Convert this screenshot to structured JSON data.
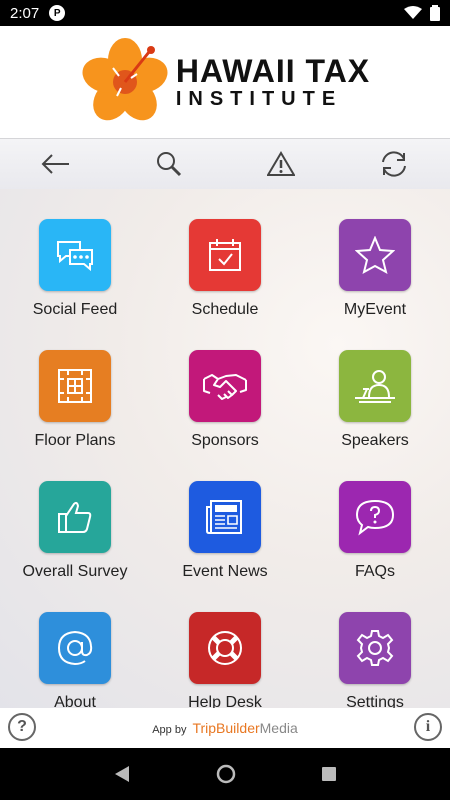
{
  "status_bar": {
    "time": "2:07",
    "notification_badge": "P"
  },
  "header": {
    "logo_line1": "HAWAII TAX",
    "logo_line2": "INSTITUTE"
  },
  "toolbar": {
    "icons": [
      "back-arrow-icon",
      "search-icon",
      "alert-icon",
      "refresh-icon"
    ]
  },
  "tiles": [
    {
      "label": "Social Feed",
      "color": "#29B6F6",
      "icon": "chat-bubbles-icon"
    },
    {
      "label": "Schedule",
      "color": "#E53935",
      "icon": "calendar-icon"
    },
    {
      "label": "MyEvent",
      "color": "#8E44AD",
      "icon": "star-icon"
    },
    {
      "label": "Floor Plans",
      "color": "#E67E22",
      "icon": "floor-plan-icon"
    },
    {
      "label": "Sponsors",
      "color": "#C2187A",
      "icon": "handshake-icon"
    },
    {
      "label": "Speakers",
      "color": "#8CB63F",
      "icon": "speaker-icon"
    },
    {
      "label": "Overall Survey",
      "color": "#26A69A",
      "icon": "thumbs-up-icon"
    },
    {
      "label": "Event News",
      "color": "#1E5BE0",
      "icon": "newspaper-icon"
    },
    {
      "label": "FAQs",
      "color": "#9C27B0",
      "icon": "question-bubble-icon"
    },
    {
      "label": "About",
      "color": "#2E8FDB",
      "icon": "at-sign-icon"
    },
    {
      "label": "Help Desk",
      "color": "#C62828",
      "icon": "lifebuoy-icon"
    },
    {
      "label": "Settings",
      "color": "#8E44AD",
      "icon": "gear-icon"
    }
  ],
  "footer": {
    "help_icon": "question-circle-icon",
    "info_icon": "info-circle-icon",
    "credit_prefix": "App by",
    "credit_brand_part1": "TripBuilder",
    "credit_brand_part2": "Media",
    "help_glyph": "?",
    "info_glyph": "i"
  }
}
